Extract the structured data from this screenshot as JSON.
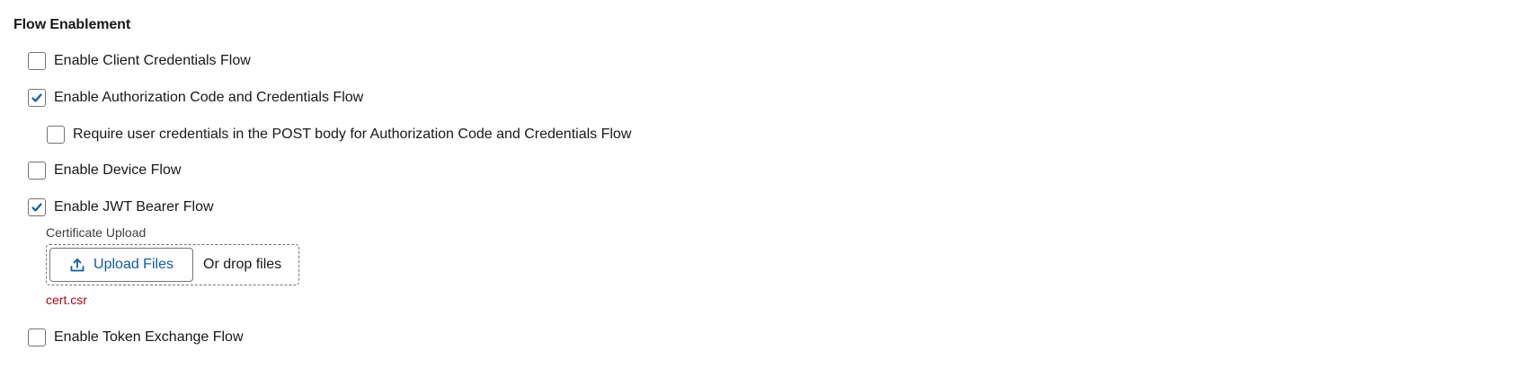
{
  "section": {
    "title": "Flow Enablement"
  },
  "options": {
    "client_credentials": {
      "label": "Enable Client Credentials Flow",
      "checked": false
    },
    "auth_code_credentials": {
      "label": "Enable Authorization Code and Credentials Flow",
      "checked": true
    },
    "require_post_body": {
      "label": "Require user credentials in the POST body for Authorization Code and Credentials Flow",
      "checked": false
    },
    "device_flow": {
      "label": "Enable Device Flow",
      "checked": false
    },
    "jwt_bearer": {
      "label": "Enable JWT Bearer Flow",
      "checked": true
    },
    "token_exchange": {
      "label": "Enable Token Exchange Flow",
      "checked": false
    }
  },
  "certificate_upload": {
    "label": "Certificate Upload",
    "button_label": "Upload Files",
    "button_icon": "upload-icon",
    "drop_text": "Or drop files",
    "file_name": "cert.csr"
  },
  "colors": {
    "check": "#0b5cab",
    "link_blue": "#0b5cab",
    "file_error_red": "#ba0517",
    "border": "#747474"
  }
}
